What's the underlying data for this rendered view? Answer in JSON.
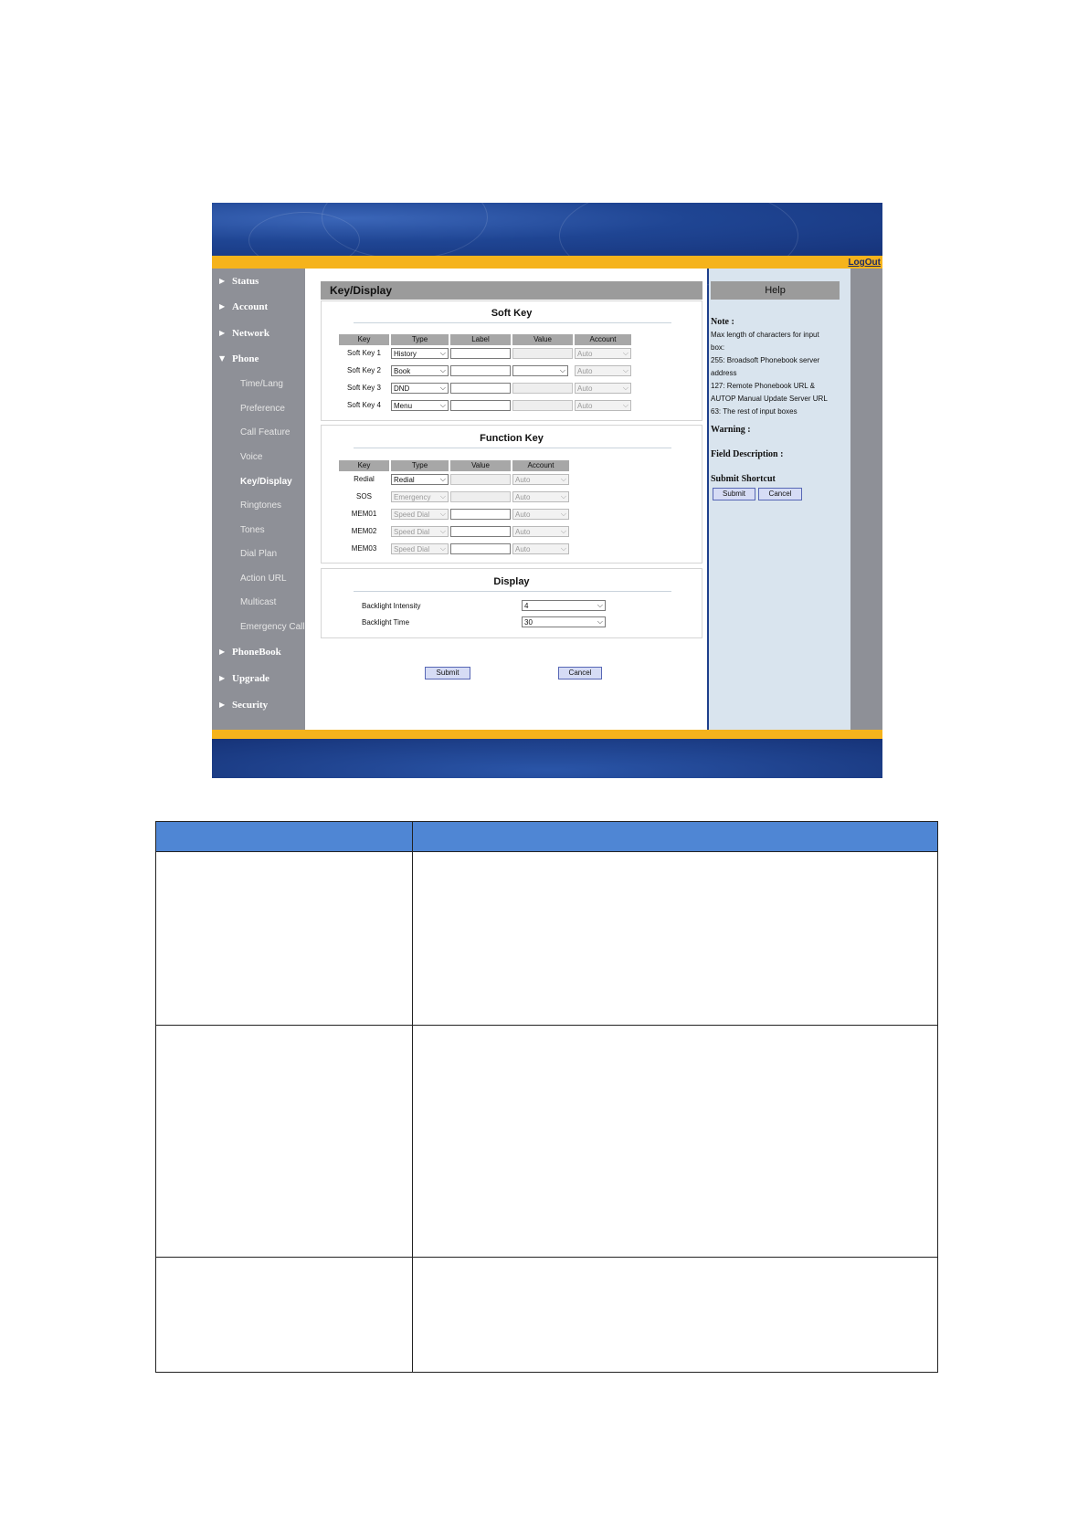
{
  "window": {
    "logout_label": "LogOut"
  },
  "sidebar": {
    "main_top": [
      "Status",
      "Account",
      "Network",
      "Phone"
    ],
    "phone_sub": [
      "Time/Lang",
      "Preference",
      "Call Feature",
      "Voice",
      "Key/Display",
      "Ringtones",
      "Tones",
      "Dial Plan",
      "Action URL",
      "Multicast",
      "Emergency Call"
    ],
    "main_bottom": [
      "PhoneBook",
      "Upgrade",
      "Security"
    ],
    "active": "Key/Display"
  },
  "page": {
    "title": "Key/Display"
  },
  "soft_key": {
    "title": "Soft Key",
    "headers": [
      "Key",
      "Type",
      "Label",
      "Value",
      "Account"
    ],
    "rows": [
      {
        "key": "Soft Key 1",
        "type": "History",
        "label": "",
        "value": "",
        "account": "Auto"
      },
      {
        "key": "Soft Key 2",
        "type": "Book",
        "label": "",
        "value": "",
        "account": "Auto"
      },
      {
        "key": "Soft Key 3",
        "type": "DND",
        "label": "",
        "value": "",
        "account": "Auto"
      },
      {
        "key": "Soft Key 4",
        "type": "Menu",
        "label": "",
        "value": "",
        "account": "Auto"
      }
    ]
  },
  "function_key": {
    "title": "Function Key",
    "headers": [
      "Key",
      "Type",
      "Value",
      "Account"
    ],
    "rows": [
      {
        "key": "Redial",
        "type": "Redial",
        "value": "",
        "account": "Auto"
      },
      {
        "key": "SOS",
        "type": "Emergency",
        "value": "",
        "account": "Auto"
      },
      {
        "key": "MEM01",
        "type": "Speed Dial",
        "value": "",
        "account": "Auto"
      },
      {
        "key": "MEM02",
        "type": "Speed Dial",
        "value": "",
        "account": "Auto"
      },
      {
        "key": "MEM03",
        "type": "Speed Dial",
        "value": "",
        "account": "Auto"
      }
    ]
  },
  "display": {
    "title": "Display",
    "backlight_intensity_label": "Backlight Intensity",
    "backlight_intensity_value": "4",
    "backlight_time_label": "Backlight Time",
    "backlight_time_value": "30"
  },
  "actions": {
    "submit": "Submit",
    "cancel": "Cancel"
  },
  "help": {
    "title": "Help",
    "note_label": "Note :",
    "note_lines": [
      "Max length of characters for input",
      "box:",
      "255: Broadsoft Phonebook server",
      "address",
      "127: Remote Phonebook URL &",
      "AUTOP Manual Update Server URL",
      "63: The rest of input boxes"
    ],
    "warning_label": "Warning :",
    "field_description_label": "Field Description :",
    "submit_shortcut_label": "Submit Shortcut",
    "submit": "Submit",
    "cancel": "Cancel"
  }
}
